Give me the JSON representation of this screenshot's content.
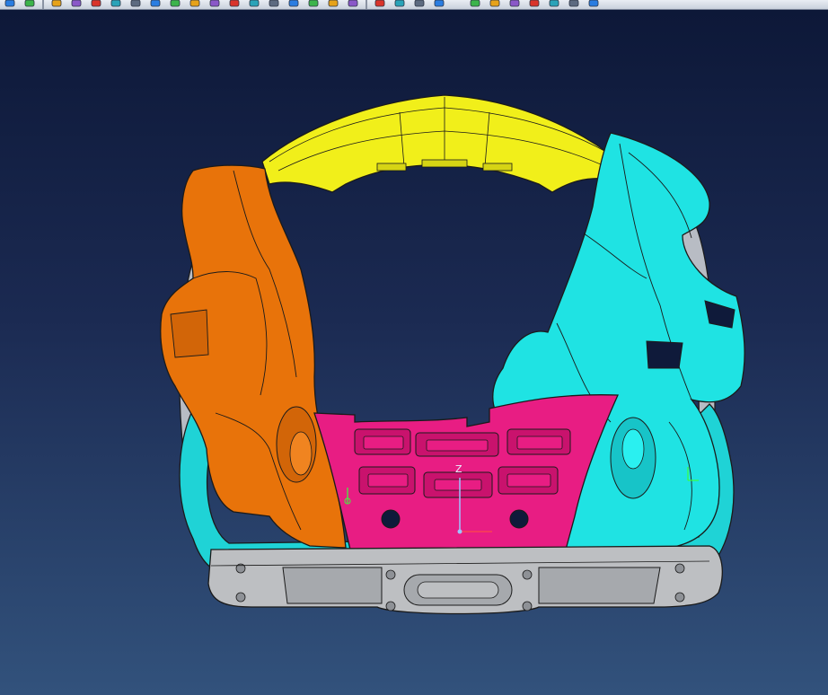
{
  "toolbar": {
    "icons": [
      "plus-icon",
      "minus-icon",
      "sep",
      "sketch-icon",
      "undo-icon",
      "check-icon",
      "number-icon",
      "tools-icon",
      "pen-icon",
      "search-icon",
      "hook-icon",
      "wrench-icon",
      "shield-icon",
      "shield-down-icon",
      "cube-icon",
      "cube-down-icon",
      "gear-green-icon",
      "link-icon",
      "arrow-icon",
      "sep",
      "pan-icon",
      "cylinder-icon",
      "cylinder2-icon",
      "cylinder3-icon",
      "spacer",
      "doc-icon",
      "doc2-icon",
      "doc3-icon",
      "doc4-icon",
      "doc5-icon",
      "cross-icon",
      "grid-icon"
    ]
  },
  "viewport": {
    "compass_axis_label": "Z",
    "colors": {
      "top_part": "#f1ef1a",
      "left_part": "#e8730a",
      "right_part": "#1fe3e3",
      "center_part": "#e81d83",
      "bottom_part": "#bdbfc2",
      "frame_part": "#1fd3d6",
      "edge": "#1a1a1a"
    }
  }
}
